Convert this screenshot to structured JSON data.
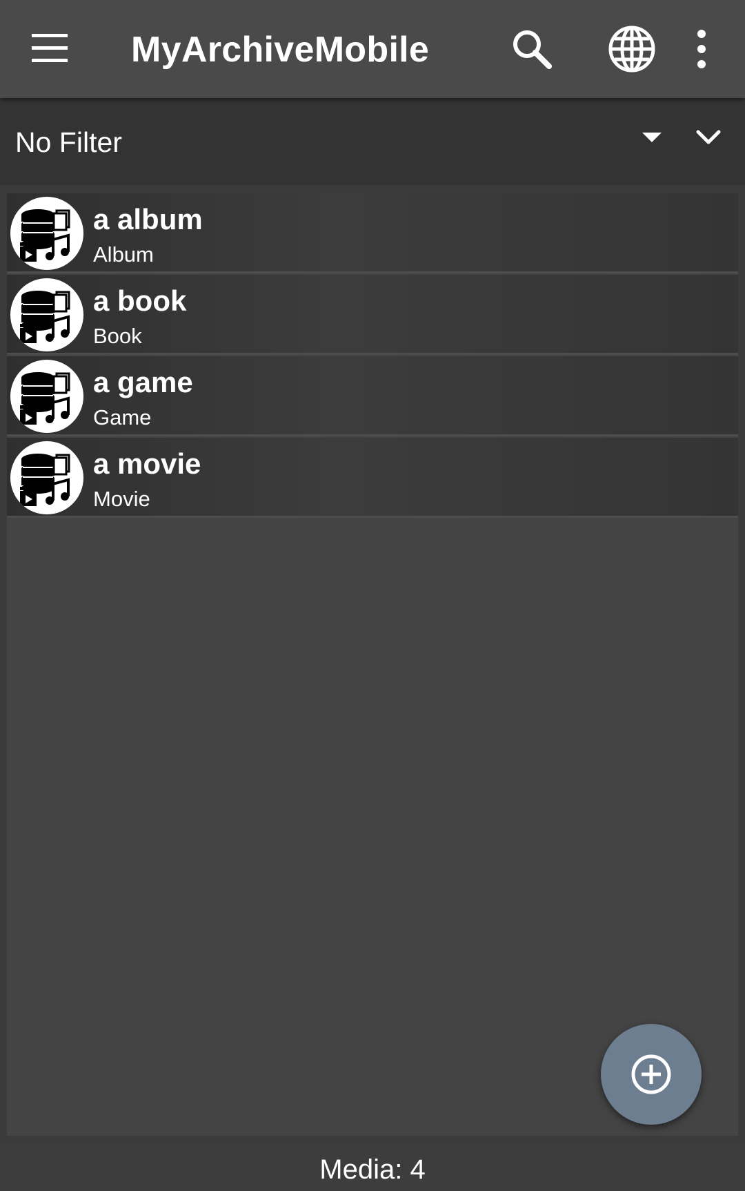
{
  "app": {
    "title": "MyArchiveMobile"
  },
  "toolbar": {
    "menu_icon": "hamburger-menu-icon",
    "search_icon": "search-icon",
    "language_icon": "globe-icon",
    "more_icon": "more-vert-icon"
  },
  "filter": {
    "selected": "No Filter"
  },
  "items": [
    {
      "title": "a album",
      "subtitle": "Album",
      "icon": "media-archive-icon"
    },
    {
      "title": "a book",
      "subtitle": "Book",
      "icon": "media-archive-icon"
    },
    {
      "title": "a game",
      "subtitle": "Game",
      "icon": "media-archive-icon"
    },
    {
      "title": "a movie",
      "subtitle": "Movie",
      "icon": "media-archive-icon"
    }
  ],
  "fab": {
    "icon": "add-circle-icon"
  },
  "footer": {
    "media_count": "Media: 4"
  },
  "colors": {
    "appbar": "#4a4a4a",
    "filterbar": "#333333",
    "list_background": "#444444",
    "fab": "#6d7e90",
    "text": "#ffffff"
  }
}
